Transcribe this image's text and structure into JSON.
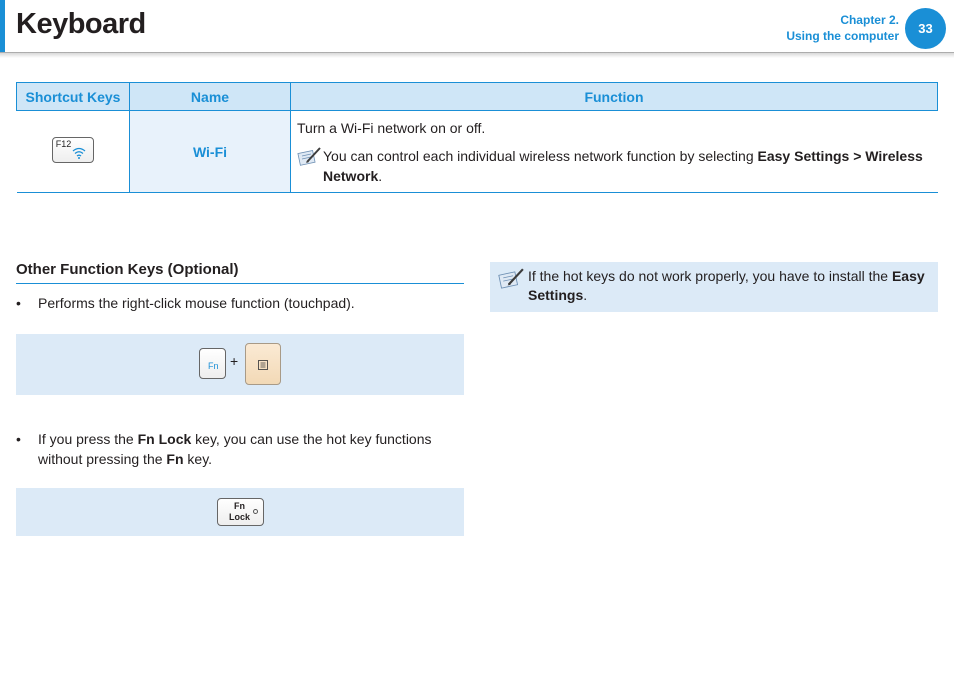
{
  "header": {
    "title": "Keyboard",
    "chapter_line1": "Chapter 2.",
    "chapter_line2": "Using the computer",
    "page_number": "33",
    "accent_color": "#1a8fd6"
  },
  "table": {
    "columns": [
      "Shortcut Keys",
      "Name",
      "Function"
    ],
    "rows": [
      {
        "key_label": "F12",
        "key_icon": "wifi-icon",
        "name": "Wi-Fi",
        "function": "Turn a Wi-Fi network on or off.",
        "note_prefix": "You can control each individual wireless network function by selecting ",
        "note_bold1": "Easy Settings >",
        "note_bold2": "Wireless Network",
        "note_suffix": "."
      }
    ]
  },
  "other_keys": {
    "title": "Other Function Keys (Optional)",
    "bullet1": "Performs the right-click mouse function (touchpad).",
    "fn_key_label": "Fn",
    "plus": "+",
    "menu_key_icon": "menu-key-icon",
    "bullet2_a": "If you press the ",
    "bullet2_bold1": "Fn Lock",
    "bullet2_b": " key, you can use the hot key functions without pressing the ",
    "bullet2_bold2": "Fn",
    "bullet2_c": " key.",
    "fnlock_line1": "Fn",
    "fnlock_line2": "Lock"
  },
  "note": {
    "text": "If the hot keys do not work properly, you have to install the ",
    "bold": "Easy Settings",
    "suffix": "."
  }
}
